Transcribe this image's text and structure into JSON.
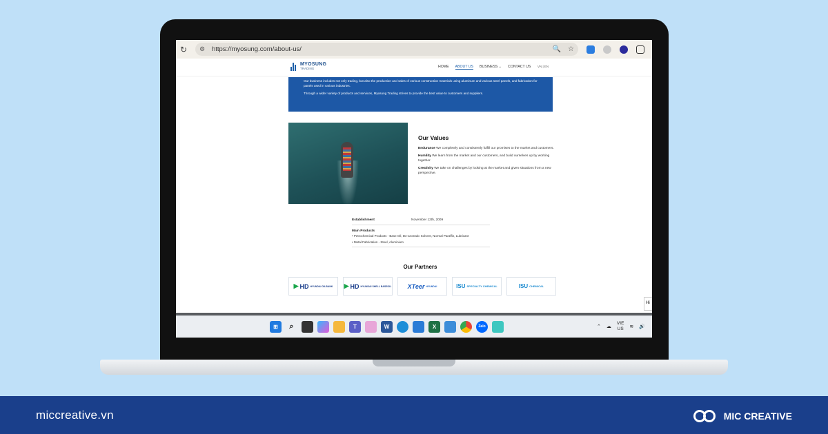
{
  "browser": {
    "url": "https://myosung.com/about-us/",
    "reload_icon": "reload-icon",
    "zoom_icon": "zoom-icon",
    "star_icon": "bookmark-star-icon"
  },
  "site": {
    "logo_name": "MYOSUNG",
    "logo_sub": "TRADING",
    "nav": [
      "HOME",
      "ABOUT US",
      "BUSINESS ⌄",
      "CONTACT US"
    ],
    "lang": "VN | EN",
    "banner_p1": "Our business includes not only trading, but also the production and sales of various construction materials using aluminum and various steel panels, and fabrication for panels used in various industries.",
    "banner_p2": "Through a wider variety of products and services, Myosung Trading strives to provide the best value to customers and suppliers.",
    "values_title": "Our Values",
    "values": [
      {
        "term": "Endurance",
        "text": " We completely and consistently fulfill our promises to the market and customers."
      },
      {
        "term": "Humility",
        "text": " We learn from the market and our customers, and build ourselves up by working together."
      },
      {
        "term": "Creativity",
        "text": " We take on challenges by looking at the market and given situations from a new perspective."
      }
    ],
    "establishment_label": "Establishment",
    "establishment_value": "November 12th, 2009",
    "products_title": "Main Products",
    "products": [
      "Petrochemical Products - Base Oil, De-aromatic Solvent, Normal Paraffin, Lubricant",
      "Metal Fabrication - Steel, Aluminium"
    ],
    "partners_title": "Our Partners",
    "partners": [
      {
        "mark": "▶",
        "name": "HD",
        "sub": "HYUNDAI OILBANK"
      },
      {
        "mark": "▶",
        "name": "HD",
        "sub": "HYUNDAI SHELL BASEOIL"
      },
      {
        "name": "XTeer",
        "sub": "HYUNDAI"
      },
      {
        "name": "ISU",
        "sub": "SPECIALTY CHEMICAL"
      },
      {
        "name": "ISU",
        "sub": "CHEMICAL"
      }
    ],
    "chat": "Hi"
  },
  "taskbar": {
    "lang_top": "VIE",
    "lang_bottom": "US"
  },
  "footer": {
    "site": "miccreative.vn",
    "brand": "MIC CREATIVE"
  }
}
